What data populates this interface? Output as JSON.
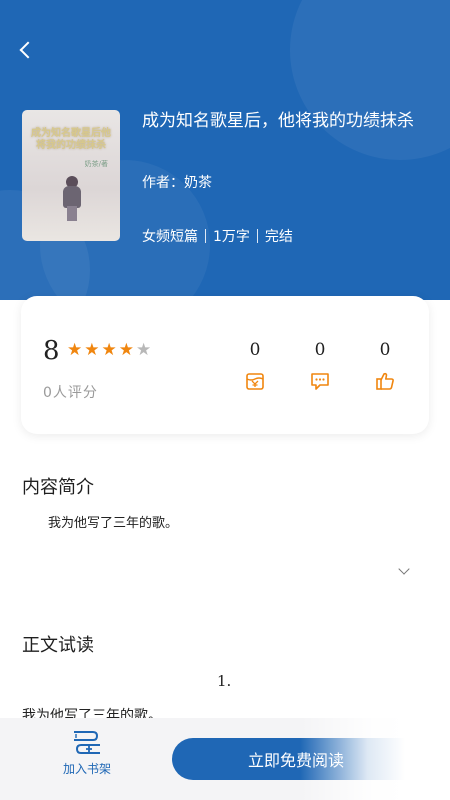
{
  "book": {
    "title": "成为知名歌星后，他将我的功绩抹杀",
    "author_label": "作者：奶茶",
    "category": "女频短篇",
    "word_count": "1万字",
    "status": "完结",
    "cover": {
      "title_text": "成为知名歌星后他将我的功绩抹杀",
      "author_text": "奶茶/著"
    }
  },
  "rating": {
    "score": "8",
    "stars_filled": 4,
    "stars_total": 5,
    "raters": "0人评分",
    "stats": [
      {
        "icon": "ticket-icon",
        "value": "0"
      },
      {
        "icon": "comment-icon",
        "value": "0"
      },
      {
        "icon": "thumbs-up-icon",
        "value": "0"
      }
    ]
  },
  "intro": {
    "heading": "内容简介",
    "text": "我为他写了三年的歌。"
  },
  "preview": {
    "heading": "正文试读",
    "chapter": "1.",
    "text": "我为他写了三年的歌。"
  },
  "bottom": {
    "shelf_label": "加入书架",
    "read_label": "立即免费阅读"
  },
  "colors": {
    "brand_blue": "#1f67b5",
    "star_orange": "#f0860f",
    "icon_orange": "#f0860f"
  }
}
